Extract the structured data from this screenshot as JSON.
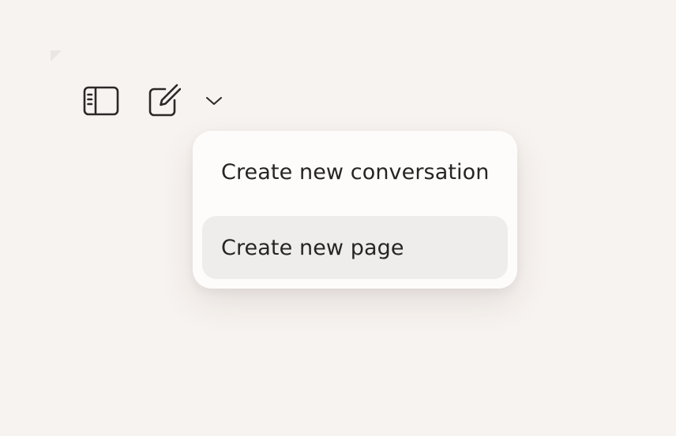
{
  "toolbar": {
    "sidebar_icon": "sidebar-toggle-icon",
    "compose_icon": "compose-edit-icon",
    "dropdown_icon": "chevron-down-icon"
  },
  "menu": {
    "items": [
      {
        "label": "Create new conversation",
        "highlighted": false
      },
      {
        "label": "Create new page",
        "highlighted": true
      }
    ]
  },
  "colors": {
    "background": "#f7f3f0",
    "menu_background": "#fdfcfb",
    "highlight": "#efedeb",
    "text": "#262424",
    "icon": "#2a2828"
  }
}
